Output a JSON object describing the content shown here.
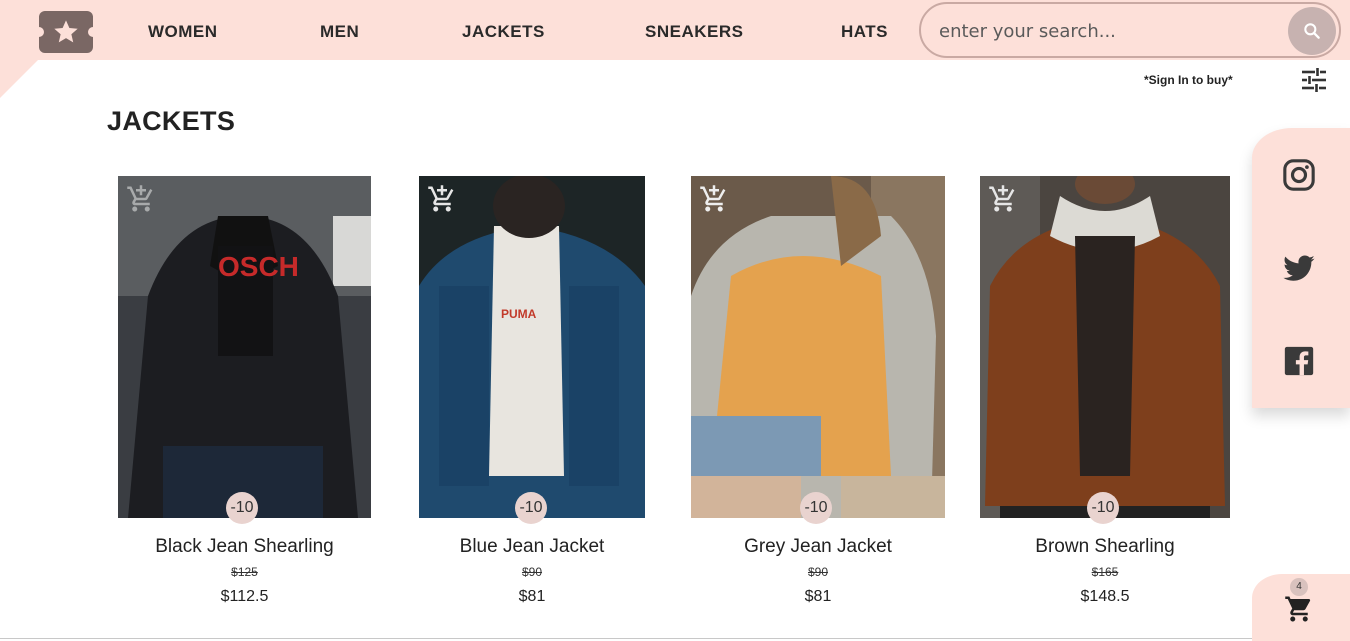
{
  "header": {
    "nav": [
      "WOMEN",
      "MEN",
      "JACKETS",
      "SNEAKERS",
      "HATS"
    ],
    "search_placeholder": "enter your search..."
  },
  "sign_in_note": "*Sign In to buy*",
  "page_title": "JACKETS",
  "products": [
    {
      "name": "Black Jean Shearling",
      "old_price": "$125",
      "price": "$112.5",
      "discount": "-10"
    },
    {
      "name": "Blue Jean Jacket",
      "old_price": "$90",
      "price": "$81",
      "discount": "-10"
    },
    {
      "name": "Grey Jean Jacket",
      "old_price": "$90",
      "price": "$81",
      "discount": "-10"
    },
    {
      "name": "Brown Shearling",
      "old_price": "$165",
      "price": "$148.5",
      "discount": "-10"
    }
  ],
  "social": [
    "instagram-icon",
    "twitter-icon",
    "facebook-icon"
  ],
  "cart": {
    "count": "4"
  },
  "colors": {
    "accent": "#fde0d9",
    "logo": "#7a6764"
  }
}
